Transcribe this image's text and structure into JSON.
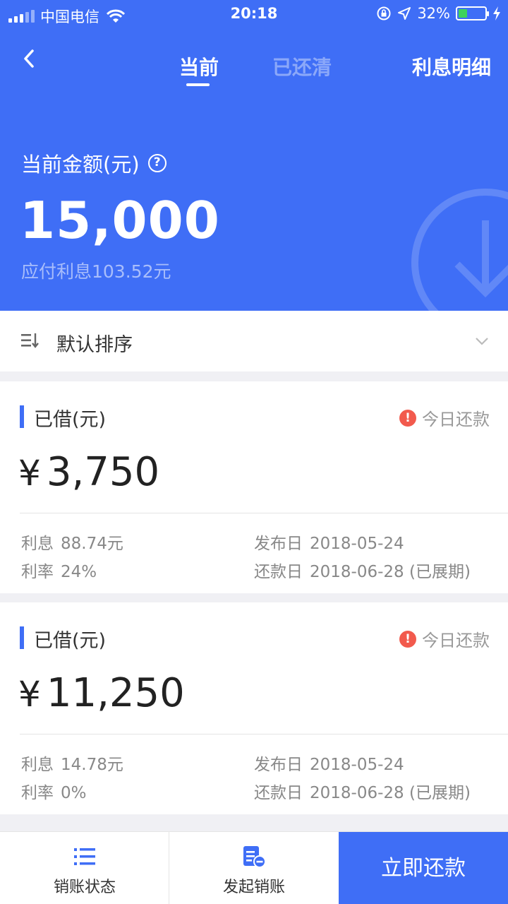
{
  "status_bar": {
    "carrier": "中国电信",
    "time": "20:18",
    "battery": "32%",
    "battery_level": 0.32,
    "icons": [
      "signal-icon",
      "wifi-icon",
      "rotation-lock-icon",
      "location-icon",
      "battery-icon",
      "charging-icon"
    ]
  },
  "nav": {
    "back_icon": "chevron-left-icon",
    "tabs": [
      {
        "label": "当前",
        "active": true
      },
      {
        "label": "已还清",
        "active": false
      }
    ],
    "detail_link": "利息明细"
  },
  "summary": {
    "label": "当前金额(元)",
    "help_icon": "question-icon",
    "amount": "15,000",
    "interest_due": "应付利息103.52元"
  },
  "sort": {
    "label": "默认排序",
    "icon": "sort-icon",
    "chevron": "chevron-down-icon"
  },
  "loans": [
    {
      "title": "已借(元)",
      "status": "今日还款",
      "currency": "¥",
      "amount": "3,750",
      "interest_key": "利息",
      "interest_val": "88.74元",
      "rate_key": "利率",
      "rate_val": "24%",
      "issue_key": "发布日",
      "issue_val": "2018-05-24",
      "repay_key": "还款日",
      "repay_val": "2018-06-28 (已展期)"
    },
    {
      "title": "已借(元)",
      "status": "今日还款",
      "currency": "¥",
      "amount": "11,250",
      "interest_key": "利息",
      "interest_val": "14.78元",
      "rate_key": "利率",
      "rate_val": "0%",
      "issue_key": "发布日",
      "issue_val": "2018-05-24",
      "repay_key": "还款日",
      "repay_val": "2018-06-28 (已展期)"
    }
  ],
  "bottom_bar": {
    "status_label": "销账状态",
    "start_label": "发起销账",
    "pay_label": "立即还款"
  },
  "colors": {
    "primary": "#3f6ef6",
    "warning": "#f25a4d",
    "battery": "#3ed35b"
  }
}
